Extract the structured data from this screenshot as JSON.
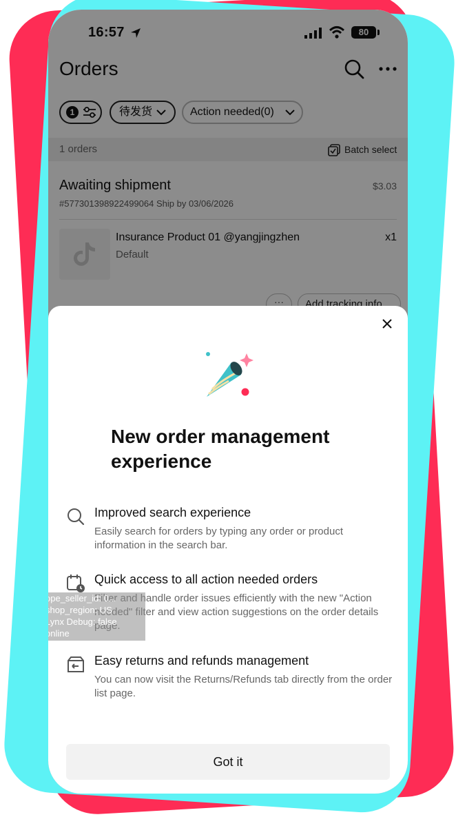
{
  "status_bar": {
    "time": "16:57",
    "battery": "80"
  },
  "header": {
    "title": "Orders"
  },
  "filters": {
    "count_badge": "1",
    "status_chip": "待发货",
    "action_chip": "Action needed(0)"
  },
  "summary": {
    "count": "1 orders",
    "batch_select": "Batch select"
  },
  "order": {
    "status": "Awaiting shipment",
    "price": "$3.03",
    "meta": "#577301398922499064  Ship by 03/06/2026",
    "product_name": "Insurance Product 01 @yangjingzhen",
    "product_variant": "Default",
    "quantity": "x1",
    "more_label": "···",
    "tracking_label": "Add tracking info"
  },
  "modal": {
    "title": "New order management experience",
    "features": [
      {
        "icon": "search-icon",
        "title": "Improved search experience",
        "description": "Easily search for orders by typing any order or product information in the search bar."
      },
      {
        "icon": "calendar-clock-icon",
        "title": "Quick access to all action needed orders",
        "description": "Filter and handle order issues efficiently with the new \"Action needed\" filter and view action suggestions on the order details page."
      },
      {
        "icon": "return-box-icon",
        "title": "Easy returns and refunds management",
        "description": "You can now visit the Returns/Refunds tab directly from the order list page."
      }
    ],
    "button": "Got it"
  },
  "debug_overlay": {
    "line1": "ope_seller_id: 0...",
    "line2": "shop_region: US",
    "line3": "Lynx Debug: false",
    "line4": "online"
  },
  "colors": {
    "brand_red": "#fe2c55",
    "brand_cyan": "#5df2f5",
    "confetti_teal": "#3fc1c9",
    "confetti_pink": "#fe2c55"
  }
}
